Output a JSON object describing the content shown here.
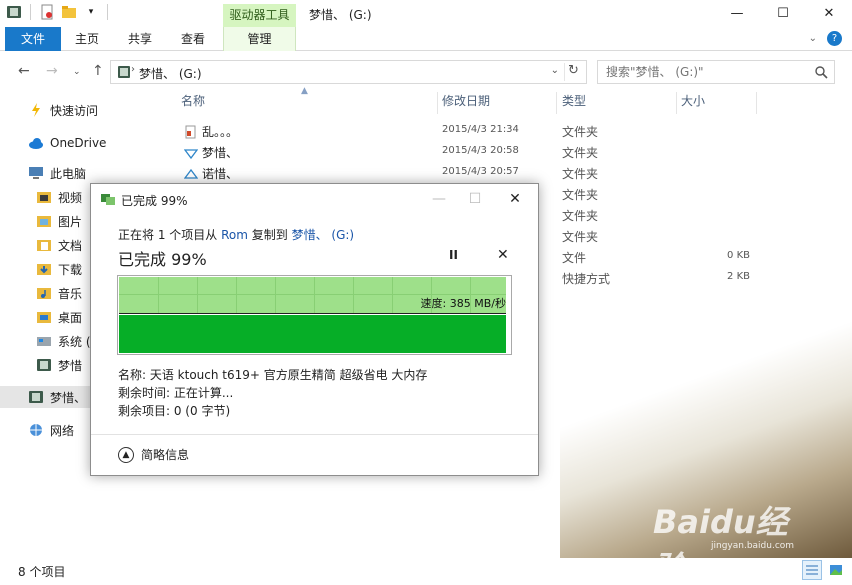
{
  "window": {
    "context_tab": "驱动器工具",
    "title": "梦惜、 (G:)",
    "minimize": "—",
    "maximize": "☐",
    "close": "✕"
  },
  "ribbon": {
    "tabs": [
      "文件",
      "主页",
      "共享",
      "查看",
      "管理"
    ],
    "expand_icon": "chevron-down-icon",
    "help": "?"
  },
  "address": {
    "path": "梦惜、 (G:)",
    "search_placeholder": "搜索\"梦惜、 (G:)\""
  },
  "sidebar": {
    "items": [
      {
        "label": "快速访问",
        "icon": "star-icon"
      },
      {
        "label": "OneDrive",
        "icon": "cloud-icon"
      },
      {
        "label": "此电脑",
        "icon": "computer-icon"
      },
      {
        "label": "视频",
        "icon": "video-folder-icon"
      },
      {
        "label": "图片",
        "icon": "picture-folder-icon"
      },
      {
        "label": "文档",
        "icon": "document-folder-icon"
      },
      {
        "label": "下载",
        "icon": "download-folder-icon"
      },
      {
        "label": "音乐",
        "icon": "music-folder-icon"
      },
      {
        "label": "桌面",
        "icon": "desktop-folder-icon"
      },
      {
        "label": "系统 (",
        "icon": "system-drive-icon"
      },
      {
        "label": "梦惜",
        "icon": "drive-icon"
      },
      {
        "label": "梦惜、",
        "icon": "drive-icon"
      },
      {
        "label": "网络",
        "icon": "network-icon"
      }
    ]
  },
  "columns": {
    "name": "名称",
    "date": "修改日期",
    "type": "类型",
    "size": "大小"
  },
  "files": [
    {
      "name": "乱。。。",
      "date": "2015/4/3 21:34",
      "type": "文件夹",
      "size": ""
    },
    {
      "name": "梦惜、",
      "date": "2015/4/3 20:58",
      "type": "文件夹",
      "size": ""
    },
    {
      "name": "诺惜、",
      "date": "2015/4/3 20:57",
      "type": "文件夹",
      "size": ""
    },
    {
      "name": "",
      "date": "",
      "type": "文件夹",
      "size": ""
    },
    {
      "name": "",
      "date": "",
      "type": "文件夹",
      "size": ""
    },
    {
      "name": "",
      "date": "",
      "type": "文件夹",
      "size": ""
    },
    {
      "name": "",
      "date": "",
      "type": "文件",
      "size": "0 KB"
    },
    {
      "name": "",
      "date": "",
      "type": "快捷方式",
      "size": "2 KB"
    }
  ],
  "status": {
    "count": "8 个项目"
  },
  "dialog": {
    "title": "已完成 99%",
    "line_prefix": "正在将 1 个项目从 ",
    "source": "Rom",
    "line_mid": " 复制到 ",
    "dest": "梦惜、 (G:)",
    "progress_text": "已完成 99%",
    "progress": 0.99,
    "speed": "速度: 385 MB/秒",
    "name_line": "名称: 天语 ktouch t619+ 官方原生精简 超级省电 大内存",
    "time_line": "剩余时间: 正在计算...",
    "items_line": "剩余项目: 0 (0 字节)",
    "less_details": "简略信息",
    "pause": "II",
    "stop": "✕"
  },
  "watermark": {
    "brand": "Baidu经验",
    "url": "jingyan.baidu.com"
  }
}
